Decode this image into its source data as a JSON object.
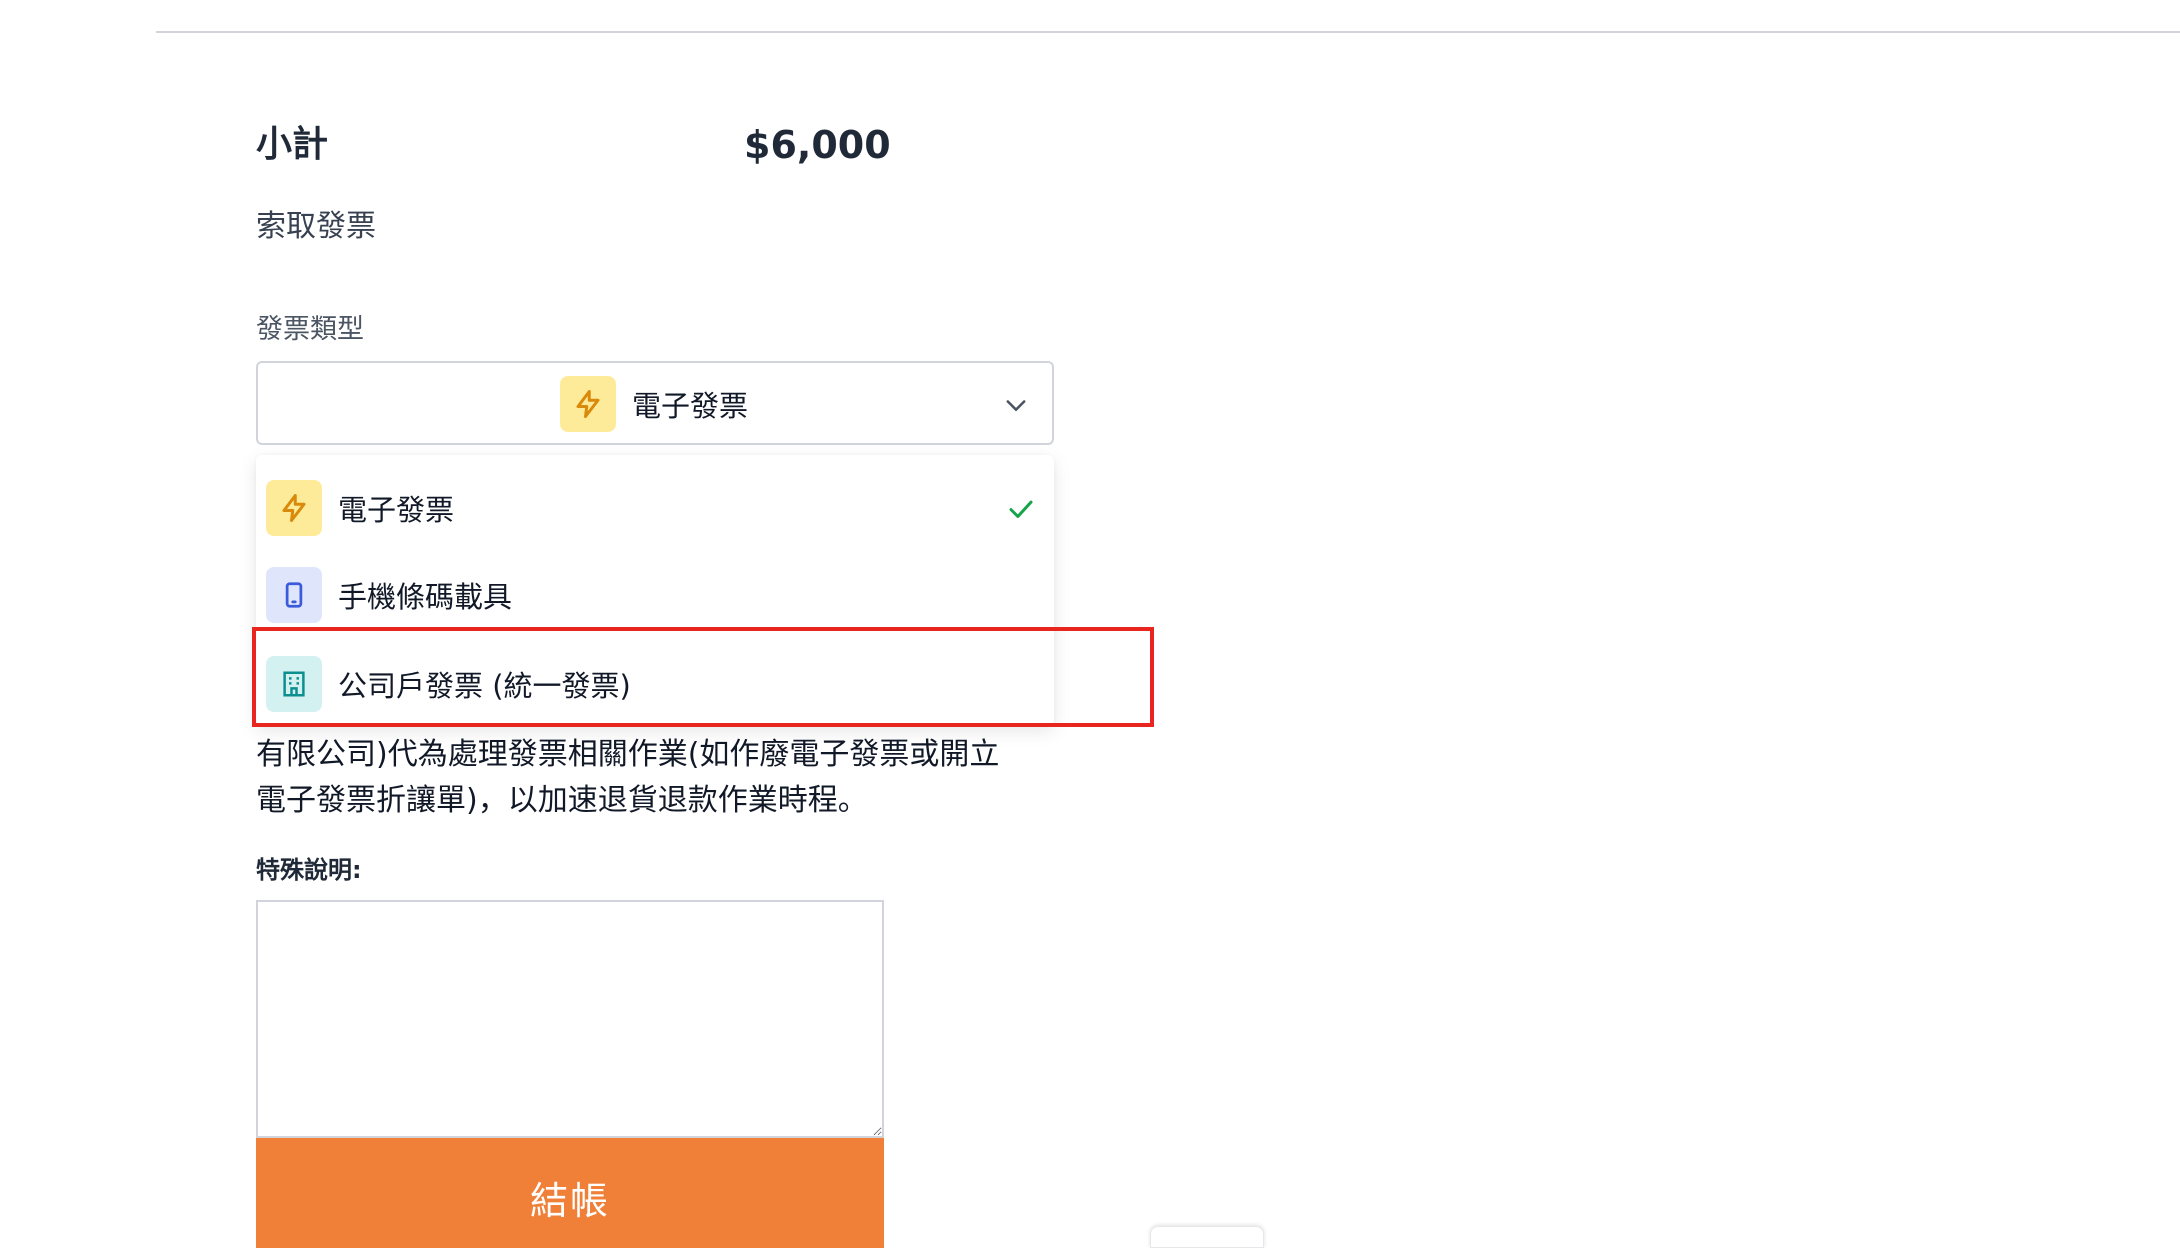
{
  "summary": {
    "subtotal_label": "小計",
    "subtotal_value": "$6,000"
  },
  "invoice": {
    "section_title": "索取發票",
    "type_label": "發票類型",
    "selected": {
      "label": "電子發票",
      "icon": "bolt-icon",
      "icon_bg": "#fdeb9a",
      "icon_color": "#d98a0a"
    },
    "options": [
      {
        "label": "電子發票",
        "icon": "bolt-icon",
        "icon_bg": "#fdeb9a",
        "icon_color": "#d98a0a",
        "selected": true
      },
      {
        "label": "手機條碼載具",
        "icon": "mobile-phone-icon",
        "icon_bg": "#dfe6fb",
        "icon_color": "#3b5bdb",
        "selected": false
      },
      {
        "label": "公司戶發票 (統一發票)",
        "icon": "building-icon",
        "icon_bg": "#d4f1f1",
        "icon_color": "#0e8f8f",
        "selected": false
      }
    ],
    "check_color": "#16a34a",
    "highlight_color": "#e8261f"
  },
  "notice": {
    "line1": "有限公司)代為處理發票相關作業(如作廢電子發票或開立",
    "line2": "電子發票折讓單)，以加速退貨退款作業時程。"
  },
  "special_notes": {
    "label": "特殊說明:",
    "value": ""
  },
  "checkout": {
    "button_label": "結帳",
    "button_color": "#f08037"
  }
}
